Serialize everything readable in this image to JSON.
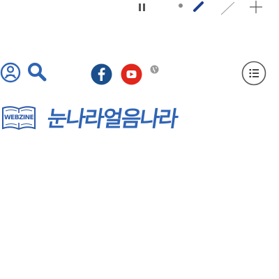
{
  "slider_controls": {
    "pause_icon": "pause-icon",
    "indicator_icon": "dot-icon",
    "pen_icon": "pen-icon",
    "slash_icon": "slash-icon",
    "plus_icon": "plus-icon"
  },
  "utility_bar": {
    "person_icon": "person-icon",
    "search_icon": "search-icon",
    "facebook_icon": "facebook-icon",
    "youtube_icon": "youtube-icon",
    "globe_icon": "globe-icon",
    "menu_icon": "list-menu-icon"
  },
  "logo": {
    "badge_text": "WEBZINE",
    "title": "눈나라얼음나라"
  },
  "colors": {
    "brand_blue": "#2f64b4",
    "facebook": "#1a4f8c",
    "youtube": "#e1261c",
    "icon_gray": "#555555"
  }
}
